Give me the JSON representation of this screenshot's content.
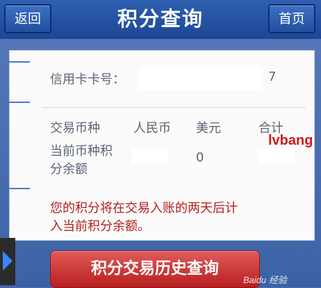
{
  "header": {
    "back_label": "返回",
    "title": "积分查询",
    "home_label": "首页"
  },
  "card": {
    "card_number_label": "信用卡卡号：",
    "card_number_tail": "7",
    "table": {
      "headers": [
        "交易币种",
        "人民币",
        "美元",
        "合计"
      ],
      "row_label_line1": "当前币种积",
      "row_label_line2": "分余额",
      "usd_value": "0"
    },
    "notice_line1": "您的积分将在交易入账的两天后计",
    "notice_line2": "入当前积分余额。"
  },
  "history_button_label": "积分交易历史查询",
  "overlay_text": "lvbang",
  "watermark": "Baidu 经验"
}
